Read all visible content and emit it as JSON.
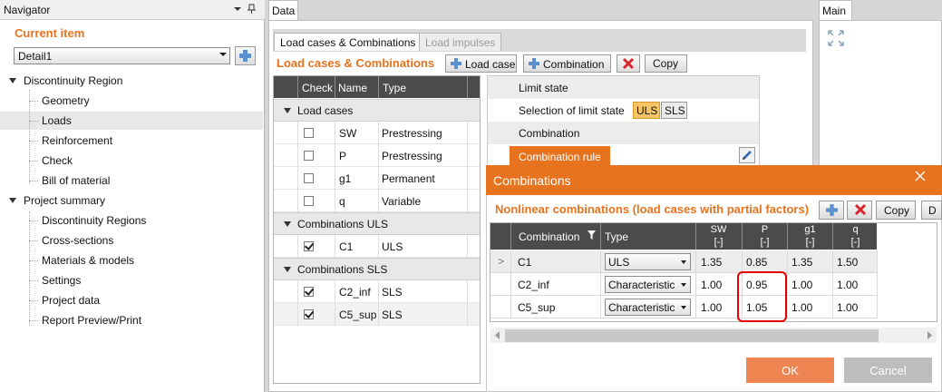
{
  "navigator": {
    "title": "Navigator",
    "current_item_label": "Current item",
    "selected_item": "Detail1",
    "tree": [
      {
        "label": "Discontinuity Region",
        "level": 0
      },
      {
        "label": "Geometry",
        "level": 1
      },
      {
        "label": "Loads",
        "level": 1,
        "selected": true
      },
      {
        "label": "Reinforcement",
        "level": 1
      },
      {
        "label": "Check",
        "level": 1
      },
      {
        "label": "Bill of material",
        "level": 1
      },
      {
        "label": "Project summary",
        "level": 0
      },
      {
        "label": "Discontinuity Regions",
        "level": 1
      },
      {
        "label": "Cross-sections",
        "level": 1
      },
      {
        "label": "Materials & models",
        "level": 1
      },
      {
        "label": "Settings",
        "level": 1
      },
      {
        "label": "Project data",
        "level": 1
      },
      {
        "label": "Report Preview/Print",
        "level": 1
      }
    ]
  },
  "data_tab": "Data",
  "main_tab": "Main",
  "inner_tabs": [
    "Load cases & Combinations",
    "Load impulses"
  ],
  "section_title": "Load cases & Combinations",
  "toolbar": {
    "load_case": "Load case",
    "combination": "Combination",
    "copy": "Copy"
  },
  "grid": {
    "headers": [
      "Check",
      "Name",
      "Type"
    ],
    "groups": [
      {
        "label": "Load cases",
        "rows": [
          {
            "checked": false,
            "name": "SW",
            "type": "Prestressing"
          },
          {
            "checked": false,
            "name": "P",
            "type": "Prestressing"
          },
          {
            "checked": false,
            "name": "g1",
            "type": "Permanent"
          },
          {
            "checked": false,
            "name": "q",
            "type": "Variable"
          }
        ]
      },
      {
        "label": "Combinations ULS",
        "rows": [
          {
            "checked": true,
            "name": "C1",
            "type": "ULS"
          }
        ]
      },
      {
        "label": "Combinations SLS",
        "rows": [
          {
            "checked": true,
            "name": "C2_inf",
            "type": "SLS"
          },
          {
            "checked": true,
            "name": "C5_sup",
            "type": "SLS"
          }
        ]
      }
    ]
  },
  "limit_state": {
    "header": "Limit state",
    "selection_label": "Selection of limit state",
    "uls": "ULS",
    "sls": "SLS",
    "combination_header": "Combination",
    "combination_rule": "Combination rule"
  },
  "dialog": {
    "title": "Combinations",
    "subtitle": "Nonlinear combinations (load cases with partial factors)",
    "copy": "Copy",
    "cut_button": "D",
    "headers": {
      "combination": "Combination",
      "type": "Type"
    },
    "factor_columns": [
      {
        "name": "SW",
        "unit": "[-]"
      },
      {
        "name": "P",
        "unit": "[-]"
      },
      {
        "name": "g1",
        "unit": "[-]"
      },
      {
        "name": "q",
        "unit": "[-]"
      }
    ],
    "rows": [
      {
        "marker": ">",
        "combination": "C1",
        "type": "ULS",
        "values": [
          "1.35",
          "0.85",
          "1.35",
          "1.50"
        ]
      },
      {
        "marker": "",
        "combination": "C2_inf",
        "type": "Characteristic",
        "values": [
          "1.00",
          "0.95",
          "1.00",
          "1.00"
        ]
      },
      {
        "marker": "",
        "combination": "C5_sup",
        "type": "Characteristic",
        "values": [
          "1.00",
          "1.05",
          "1.00",
          "1.00"
        ]
      }
    ],
    "ok": "OK",
    "cancel": "Cancel",
    "colors": {
      "accent": "#e8731f",
      "ok": "#ef8551",
      "highlight": "#e40000"
    }
  }
}
